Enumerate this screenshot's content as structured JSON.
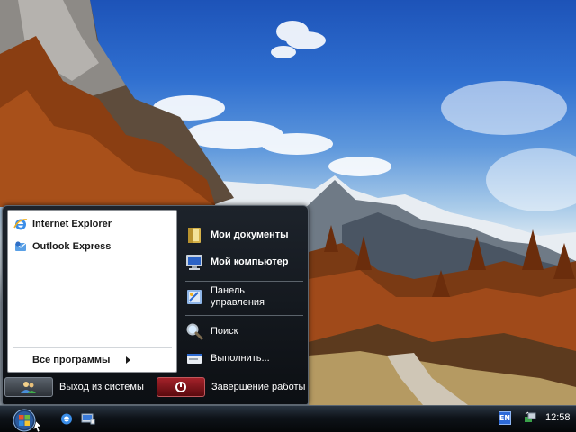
{
  "start_menu": {
    "pinned": [
      {
        "label": "Internet Explorer",
        "icon": "internet-explorer-icon"
      },
      {
        "label": "Outlook Express",
        "icon": "outlook-express-icon"
      }
    ],
    "all_programs_label": "Все программы",
    "right_items": [
      {
        "label": "Мои документы",
        "icon": "folder-icon"
      },
      {
        "label": "Мой компьютер",
        "icon": "computer-icon"
      },
      {
        "label_line1": "Панель",
        "label_line2": "управления",
        "icon": "control-panel-icon"
      },
      {
        "label": "Поиск",
        "icon": "search-icon"
      },
      {
        "label": "Выполнить...",
        "icon": "run-icon"
      }
    ],
    "logoff_label": "Выход из системы",
    "shutdown_label": "Завершение работы"
  },
  "taskbar": {
    "language": "EN",
    "clock": "12:58"
  },
  "colors": {
    "menu_bg": "#0c0f13",
    "shutdown_button": "#7a0d12",
    "logoff_button": "#3a4048",
    "lang_badge": "#2d6ad8"
  }
}
